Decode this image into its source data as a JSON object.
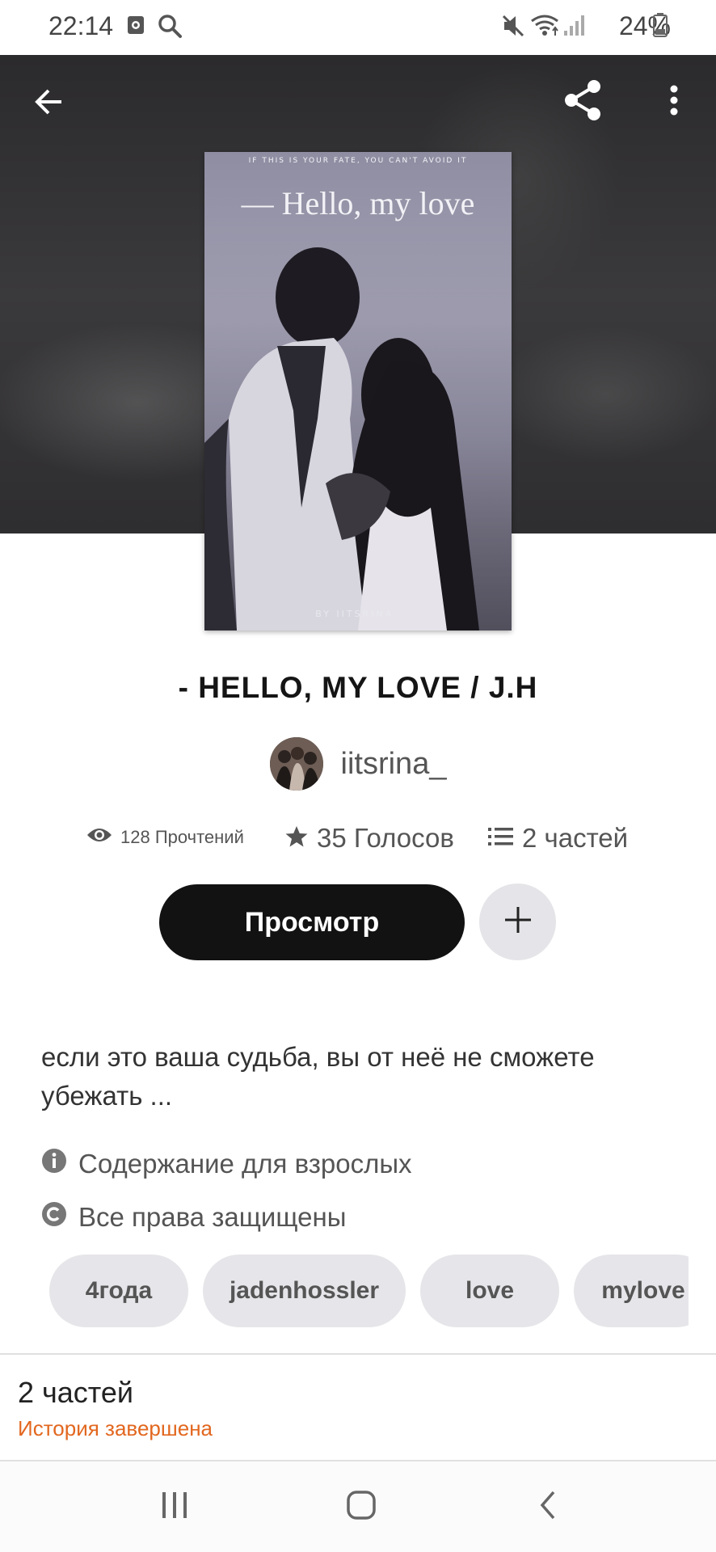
{
  "status_bar": {
    "time": "22:14",
    "battery": "24%",
    "icons": [
      "screen-record-icon",
      "search-icon",
      "mute-icon",
      "wifi-icon",
      "signal-icon",
      "battery-icon"
    ]
  },
  "header": {
    "back_icon": "arrow-left-icon",
    "share_icon": "share-icon",
    "more_icon": "more-vert-icon"
  },
  "cover": {
    "tagline": "IF THIS IS YOUR FATE, YOU CAN'T AVOID IT",
    "title": "— Hello, my love",
    "byline": "BY IITSRINA_"
  },
  "story": {
    "title": "- HELLO, MY LOVE / J.H",
    "author": "iitsrina_"
  },
  "stats": {
    "reads": "128 Прочтений",
    "votes": "35 Голосов",
    "parts": "2 частей"
  },
  "actions": {
    "read_label": "Просмотр",
    "add_icon": "plus-icon"
  },
  "description": "если это ваша судьба, вы от неё не сможете убежать ...",
  "info": {
    "mature": "Содержание для взрослых",
    "copyright": "Все права защищены"
  },
  "tags": [
    "4года",
    "jadenhossler",
    "love",
    "mylove"
  ],
  "parts_section": {
    "count": "2 частей",
    "status": "История завершена"
  },
  "colors": {
    "accent_orange": "#e2671f",
    "primary_button": "#121212",
    "chip_bg": "#e6e5e9"
  }
}
